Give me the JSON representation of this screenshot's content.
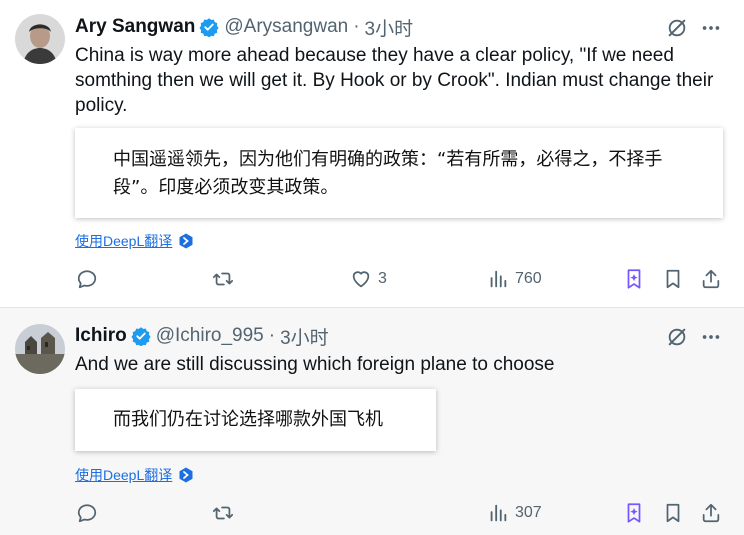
{
  "tweets": [
    {
      "name": "Ary Sangwan",
      "handle": "@Arysangwan",
      "time": "3小时",
      "text": "China is way more ahead because they have a clear policy, \"If we need somthing then we will get it. By Hook or by Crook\". Indian must change their policy.",
      "translation": "中国遥遥领先，因为他们有明确的政策：“若有所需，必得之，不择手段”。印度必须改变其政策。",
      "translate_link": "使用DeepL翻译",
      "likes": "3",
      "views": "760"
    },
    {
      "name": "Ichiro",
      "handle": "@Ichiro_995",
      "time": "3小时",
      "text": "And we are still discussing which foreign plane to choose",
      "translation": "而我们仍在讨论选择哪款外国飞机",
      "translate_link": "使用DeepL翻译",
      "likes": "",
      "views": "307"
    }
  ],
  "colors": {
    "verified": "#1d9bf0",
    "link": "#1d6fe0",
    "muted": "#536471",
    "grok": "#7856ff"
  },
  "icons": [
    "verified-badge-icon",
    "grok-icon",
    "more-icon",
    "deepl-icon",
    "reply-icon",
    "retweet-icon",
    "like-icon",
    "views-icon",
    "grok-star-icon",
    "bookmark-icon",
    "share-icon"
  ]
}
